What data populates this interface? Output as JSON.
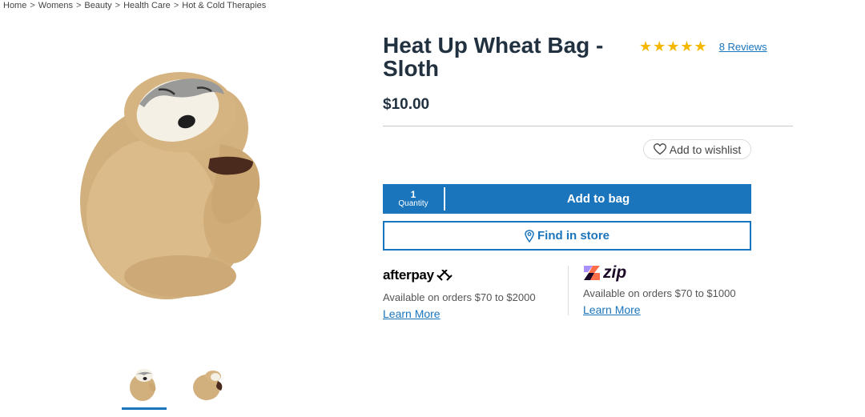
{
  "breadcrumb": {
    "items": [
      "Home",
      "Womens",
      "Beauty",
      "Health Care",
      "Hot & Cold Therapies"
    ],
    "separator": ">"
  },
  "product": {
    "title": "Heat Up Wheat Bag - Sloth",
    "rating": 5,
    "stars": "★★★★★",
    "reviews_label": "8 Reviews",
    "price": "$10.00"
  },
  "gallery": {
    "main_image": "sloth-plush-wheat-bag",
    "thumbnails": [
      "sloth-thumb-front",
      "sloth-thumb-side"
    ],
    "active_thumbnail": 0
  },
  "actions": {
    "wishlist_label": "Add to wishlist",
    "quantity_value": "1",
    "quantity_label": "Quantity",
    "add_to_bag_label": "Add to bag",
    "find_in_store_label": "Find in store"
  },
  "payments": {
    "afterpay": {
      "logo_text": "afterpay",
      "text": "Available on orders $70 to $2000",
      "learn_more": "Learn More"
    },
    "zip": {
      "logo_text": "zip",
      "text": "Available on orders $70 to $1000",
      "learn_more": "Learn More"
    }
  },
  "colors": {
    "brand_blue": "#1b75bc",
    "star_gold": "#f5b800",
    "title_dark": "#213140"
  }
}
